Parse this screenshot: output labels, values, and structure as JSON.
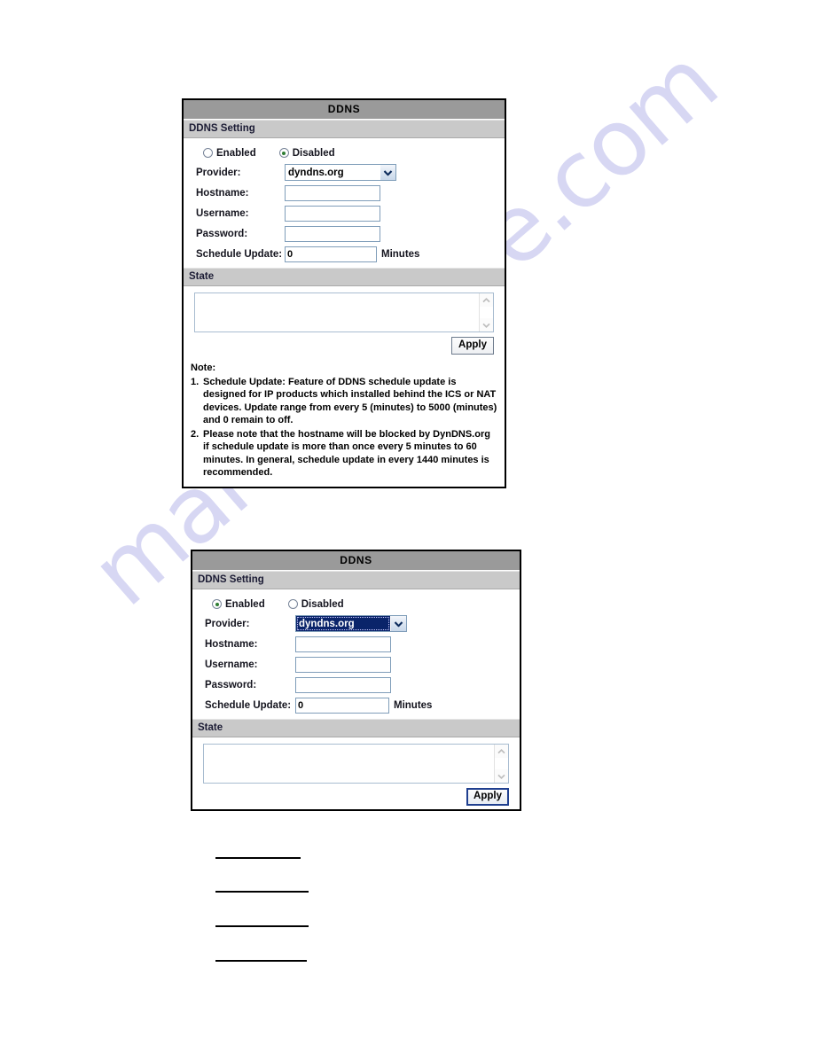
{
  "watermark": {
    "text": "manualshive.com",
    "color": "#c9c9ef"
  },
  "panels": [
    {
      "id": "ddns-disabled",
      "title": "DDNS",
      "section_label": "DDNS Setting",
      "radios": [
        {
          "label": "Enabled",
          "checked": false
        },
        {
          "label": "Disabled",
          "checked": true
        }
      ],
      "fields": [
        {
          "label": "Provider:",
          "type": "select",
          "value": "dyndns.org",
          "focused": false
        },
        {
          "label": "Hostname:",
          "type": "text",
          "value": "",
          "placeholder": ""
        },
        {
          "label": "Username:",
          "type": "text",
          "value": "",
          "placeholder": ""
        },
        {
          "label": "Password:",
          "type": "text",
          "value": "",
          "placeholder": ""
        },
        {
          "label": "Schedule Update:",
          "type": "text",
          "value": "0",
          "placeholder": "",
          "unit": "Minutes"
        }
      ],
      "state_label": "State",
      "state_value": "",
      "apply_label": "Apply",
      "apply_focused": false,
      "note": {
        "heading": "Note:",
        "items": [
          {
            "num": "1.",
            "text": "Schedule Update: Feature of DDNS schedule update is designed for IP products which installed behind the ICS or NAT devices. Update range from every 5 (minutes) to 5000 (minutes) and 0 remain to off."
          },
          {
            "num": "2.",
            "text": "Please note that the hostname will be blocked by DynDNS.org if schedule update is more than once every 5 minutes to 60 minutes. In general, schedule update in every 1440 minutes is recommended."
          }
        ]
      }
    },
    {
      "id": "ddns-enabled",
      "title": "DDNS",
      "section_label": "DDNS Setting",
      "radios": [
        {
          "label": "Enabled",
          "checked": true
        },
        {
          "label": "Disabled",
          "checked": false
        }
      ],
      "fields": [
        {
          "label": "Provider:",
          "type": "select",
          "value": "dyndns.org",
          "focused": true
        },
        {
          "label": "Hostname:",
          "type": "text",
          "value": "",
          "placeholder": ""
        },
        {
          "label": "Username:",
          "type": "text",
          "value": "",
          "placeholder": ""
        },
        {
          "label": "Password:",
          "type": "text",
          "value": "",
          "placeholder": ""
        },
        {
          "label": "Schedule Update:",
          "type": "text",
          "value": "0",
          "placeholder": "",
          "unit": "Minutes"
        }
      ],
      "state_label": "State",
      "state_value": "",
      "apply_label": "Apply",
      "apply_focused": true,
      "note": null
    }
  ],
  "provider_options": [
    "dyndns.org"
  ],
  "rule_lines": 4
}
